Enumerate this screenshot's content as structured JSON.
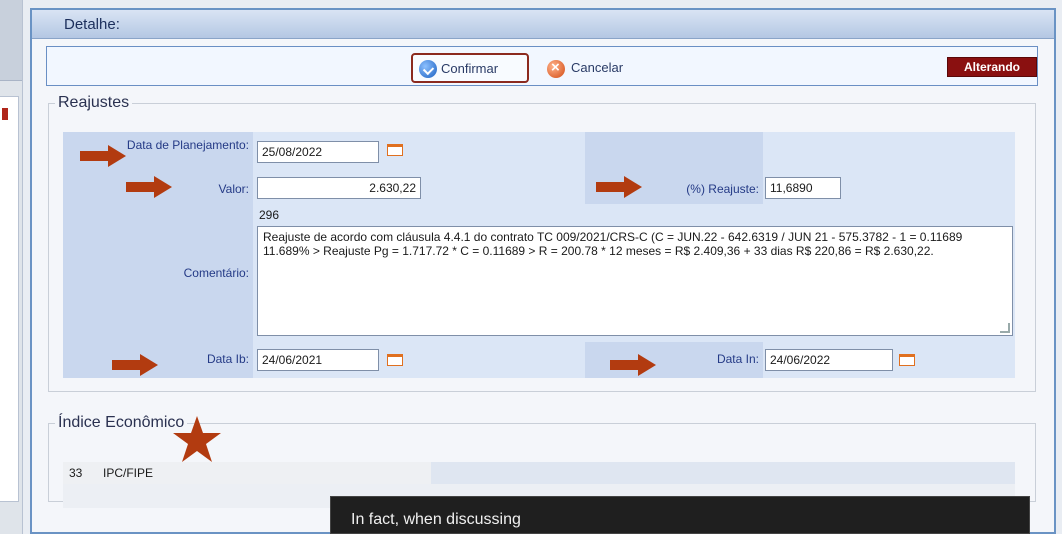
{
  "panel": {
    "title": "Detalhe:"
  },
  "toolbar": {
    "confirm_label": "Confirmar",
    "cancel_label": "Cancelar",
    "status_badge": "Alterando"
  },
  "reajustes": {
    "legend": "Reajustes",
    "data_planejamento_label": "Data de Planejamento:",
    "data_planejamento_value": "25/08/2022",
    "valor_label": "Valor:",
    "valor_value": "2.630,22",
    "reajuste_label": "(%) Reajuste:",
    "reajuste_value": "11,6890",
    "comentario_label": "Comentário:",
    "comentario_count": "296",
    "comentario_value": "Reajuste de acordo com cláusula 4.4.1 do contrato TC 009/2021/CRS-C (C = JUN.22 - 642.6319 / JUN 21 - 575.3782 - 1 = 0.11689 11.689% > Reajuste Pg = 1.717.72 * C = 0.11689 > R = 200.78 * 12 meses = R$ 2.409,36 + 33 dias R$ 220,86 = R$ 2.630,22.",
    "data_ib_label": "Data Ib:",
    "data_ib_value": "24/06/2021",
    "data_in_label": "Data In:",
    "data_in_value": "24/06/2022"
  },
  "indice": {
    "legend": "Índice Econômico",
    "code": "33",
    "name": "IPC/FIPE"
  },
  "overlay": {
    "text": "In fact, when discussing"
  },
  "colors": {
    "arrow": "#b23b10",
    "badge": "#8a1010",
    "confirm_border": "#8c2a1e"
  }
}
